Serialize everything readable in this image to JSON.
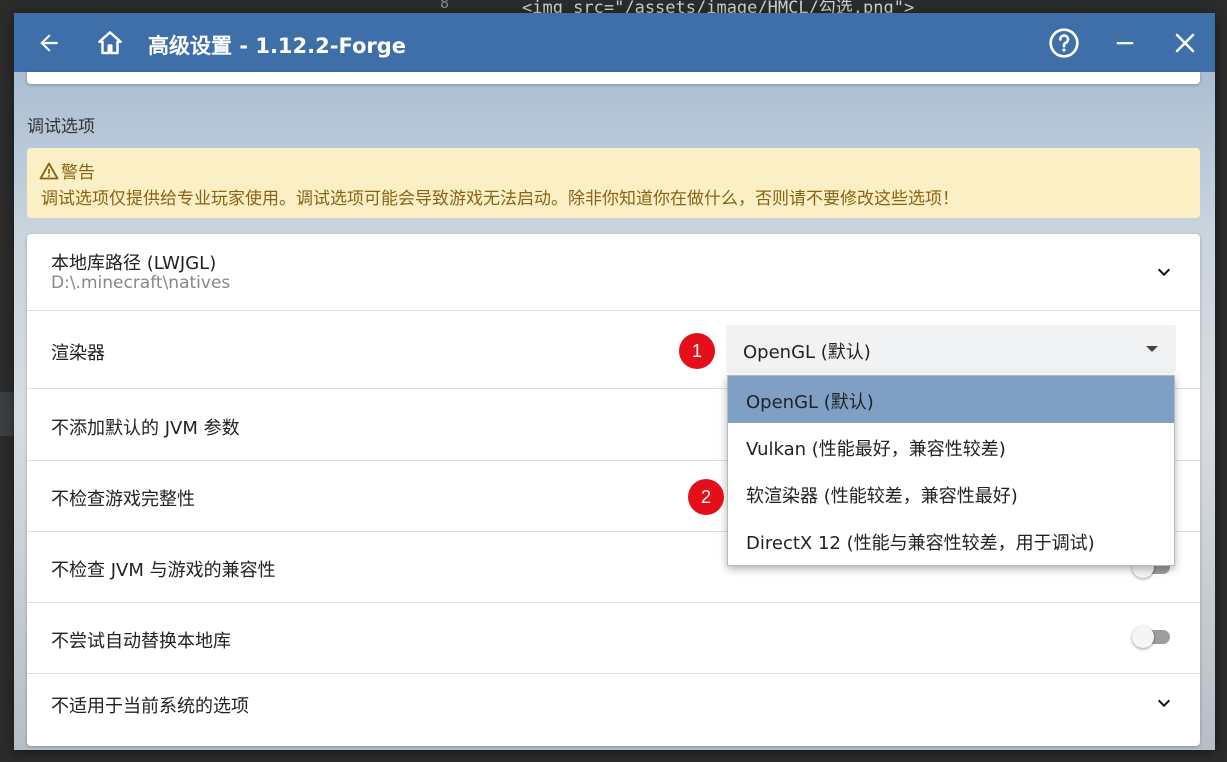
{
  "background_editor": {
    "line_number": "8",
    "code_snippet": "<img src=\"/assets/image/HMCL/勾选.png\">"
  },
  "titlebar": {
    "title": "高级设置 - 1.12.2-Forge",
    "icons": [
      "back-arrow-icon",
      "home-icon",
      "help-icon",
      "minimize-icon",
      "close-icon"
    ]
  },
  "section": {
    "title": "调试选项"
  },
  "warning": {
    "title": "警告",
    "body": "调试选项仅提供给专业玩家使用。调试选项可能会导致游戏无法启动。除非你知道你在做什么，否则请不要修改这些选项！"
  },
  "settings": {
    "native_path": {
      "label": "本地库路径 (LWJGL)",
      "value": "D:\\.minecraft\\natives"
    },
    "renderer": {
      "label": "渲染器",
      "selected": "OpenGL (默认)"
    },
    "no_default_jvm_args": {
      "label": "不添加默认的 JVM 参数"
    },
    "no_game_check": {
      "label": "不检查游戏完整性"
    },
    "no_jvm_check": {
      "label": "不检查 JVM 与游戏的兼容性",
      "enabled": false
    },
    "no_native_replace": {
      "label": "不尝试自动替换本地库",
      "enabled": false
    },
    "unsupported_options": {
      "label": "不适用于当前系统的选项"
    }
  },
  "renderer_dropdown": {
    "options": [
      "OpenGL (默认)",
      "Vulkan (性能最好，兼容性较差)",
      "软渲染器 (性能较差，兼容性最好)",
      "DirectX 12 (性能与兼容性较差，用于调试)"
    ],
    "selected_index": 0
  },
  "annotations": {
    "badge_1": "1",
    "badge_2": "2"
  },
  "colors": {
    "titlebar": "#3f6fa8",
    "warning_bg": "#fbefc5",
    "warning_text": "#8a6416",
    "dropdown_selected": "#7fa0c4",
    "badge": "#e3101a"
  }
}
